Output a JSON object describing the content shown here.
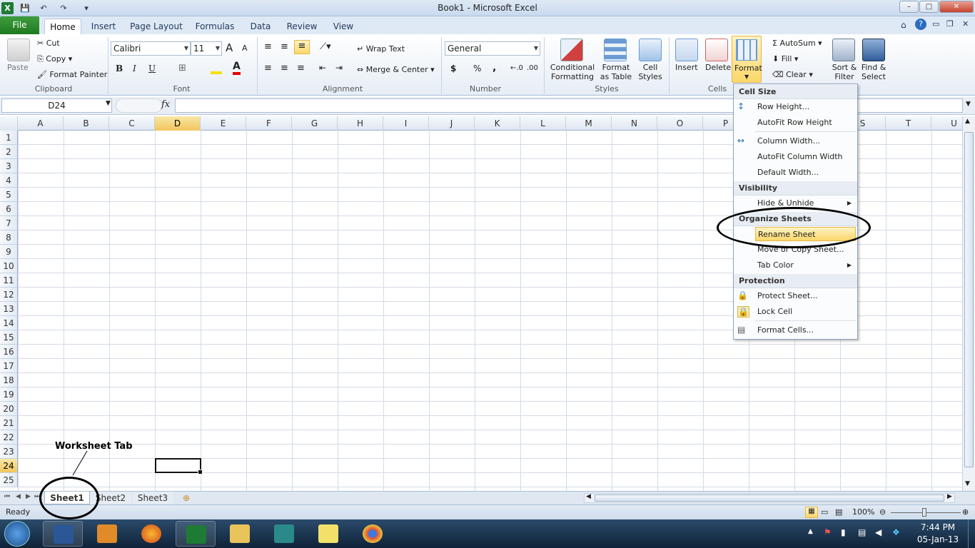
{
  "window": {
    "title": "Book1  -  Microsoft Excel",
    "minimize": "–",
    "maximize": "□",
    "close": "✕"
  },
  "qat": {
    "save": "💾",
    "undo": "↶",
    "redo": "↷",
    "customize": "▾"
  },
  "ribbon_tabs": [
    "Home",
    "Insert",
    "Page Layout",
    "Formulas",
    "Data",
    "Review",
    "View"
  ],
  "file_tab": "File",
  "clipboard": {
    "paste": "Paste",
    "cut": "Cut",
    "copy": "Copy",
    "format_painter": "Format Painter",
    "label": "Clipboard"
  },
  "font": {
    "name": "Calibri",
    "size": "11",
    "grow": "A",
    "shrink": "A",
    "bold": "B",
    "italic": "I",
    "underline": "U",
    "label": "Font"
  },
  "alignment": {
    "wrap_text": "Wrap Text",
    "merge_center": "Merge & Center",
    "label": "Alignment"
  },
  "number": {
    "format": "General",
    "currency": "$",
    "percent": "%",
    "comma": ",",
    "label": "Number"
  },
  "styles": {
    "conditional_1": "Conditional",
    "conditional_2": "Formatting",
    "table_1": "Format",
    "table_2": "as Table",
    "cell_1": "Cell",
    "cell_2": "Styles",
    "label": "Styles"
  },
  "cells_group": {
    "insert": "Insert",
    "delete": "Delete",
    "format": "Format",
    "label": "Cells"
  },
  "editing": {
    "autosum": "AutoSum",
    "fill": "Fill",
    "clear": "Clear",
    "sort_1": "Sort &",
    "sort_2": "Filter",
    "find_1": "Find &",
    "find_2": "Select"
  },
  "formula_bar": {
    "name_box": "D24",
    "fx": "fx",
    "value": ""
  },
  "columns": [
    "A",
    "B",
    "C",
    "D",
    "E",
    "F",
    "G",
    "H",
    "I",
    "J",
    "K",
    "L",
    "M",
    "N",
    "O",
    "P",
    "Q",
    "R",
    "S",
    "T",
    "U"
  ],
  "rows": [
    "1",
    "2",
    "3",
    "4",
    "5",
    "6",
    "7",
    "8",
    "9",
    "10",
    "11",
    "12",
    "13",
    "14",
    "15",
    "16",
    "17",
    "18",
    "19",
    "20",
    "21",
    "22",
    "23",
    "24",
    "25"
  ],
  "selected_cell": {
    "column": "D",
    "row": "24"
  },
  "format_menu": {
    "cell_size": "Cell Size",
    "row_height": "Row Height...",
    "autofit_row": "AutoFit Row Height",
    "column_width": "Column Width...",
    "autofit_column": "AutoFit Column Width",
    "default_width": "Default Width...",
    "visibility": "Visibility",
    "hide_unhide": "Hide & Unhide",
    "organize_sheets": "Organize Sheets",
    "rename_sheet": "Rename Sheet",
    "move_copy": "Move or Copy Sheet...",
    "tab_color": "Tab Color",
    "protection": "Protection",
    "protect_sheet": "Protect Sheet...",
    "lock_cell": "Lock Cell",
    "format_cells": "Format Cells..."
  },
  "annotation": {
    "label": "Worksheet Tab"
  },
  "sheets": [
    "Sheet1",
    "Sheet2",
    "Sheet3"
  ],
  "status": {
    "mode": "Ready",
    "zoom": "100%"
  },
  "taskbar": {
    "time": "7:44 PM",
    "date": "05-Jan-13"
  },
  "colors": {
    "accent": "#1f7a1f",
    "highlight": "#fbd76a",
    "ribbon": "#dfe9f5"
  }
}
